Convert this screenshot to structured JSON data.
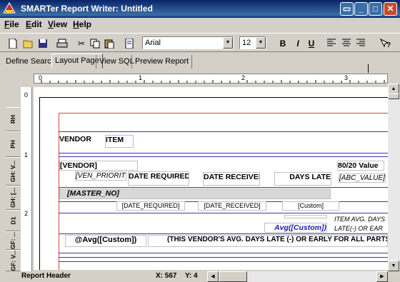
{
  "window": {
    "title": "SMARTer Report Writer: Untitled"
  },
  "menu": [
    {
      "label": "File",
      "hotkey": "F",
      "rest": "ile"
    },
    {
      "label": "Edit",
      "hotkey": "E",
      "rest": "dit"
    },
    {
      "label": "View",
      "hotkey": "V",
      "rest": "iew"
    },
    {
      "label": "Help",
      "hotkey": "H",
      "rest": "elp"
    }
  ],
  "toolbar": {
    "font": "Arial",
    "size": "12",
    "bold": "B",
    "italic": "I",
    "underline": "U"
  },
  "tabs": [
    "Define Search",
    "Layout Page",
    "View SQL",
    "Preview Report"
  ],
  "active_tab": "Layout Page",
  "ruler": {
    "h_labels": [
      "0",
      "1",
      "2",
      "3"
    ],
    "v_labels": [
      "0",
      "1",
      "2"
    ]
  },
  "bands": [
    "RH",
    "PH",
    "GH: V...",
    "GH: [...",
    "D1",
    "GF: ...",
    "GF: V..."
  ],
  "report": {
    "ph_vendor": "VENDOR",
    "ph_item": "ITEM",
    "gh_vendor_field": "[VENDOR]",
    "gh_value_label": "80/20 Value",
    "gh_priority": "[VEN_PRIORITY",
    "gh_date_required": "DATE REQUIRED",
    "gh_date_received": "DATE RECEIVED",
    "gh_days_late": "DAYS LATE",
    "gh_abc_value": "[ABC_VALUE]",
    "gh2_master_no": "[MASTER_NO]",
    "d1_date_required": "[DATE_REQUIRED]",
    "d1_date_received": "[DATE_RECEIVED]",
    "d1_custom": "[Custom]",
    "gf_avg_custom": "Avg([Custom])",
    "gf_item_avg_line1": "ITEM AVG. DAYS",
    "gf_item_avg_line2": "LATE(-) OR EAR",
    "gf2_avg": "@Avg([Custom])",
    "gf2_text": "(THIS VENDOR'S AVG. DAYS LATE (-) OR EARLY FOR ALL PARTS"
  },
  "status": {
    "section": "Report Header",
    "x": "X: 567",
    "y": "Y: 4"
  }
}
